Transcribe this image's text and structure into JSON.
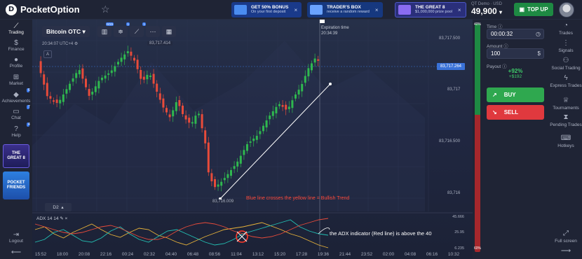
{
  "header": {
    "logo_text": "PocketOption",
    "logo_mark": "D",
    "star_icon": "☆",
    "promos": [
      {
        "title": "GET 50% BONUS",
        "subtitle": "On your first deposit",
        "close": "×"
      },
      {
        "title": "TRADER'S BOX",
        "subtitle": "receive a random reward",
        "close": "×"
      },
      {
        "title": "THE GREAT 8",
        "subtitle": "$1,000,000 prize pool",
        "close": "×"
      }
    ],
    "account_label": "QT Demo · USD",
    "balance": "49,900",
    "balance_caret": "▾",
    "topup_label": "TOP UP"
  },
  "left_sidebar": {
    "items": [
      {
        "label": "Trading",
        "icon": "chart-line-icon",
        "glyph": "📈"
      },
      {
        "label": "Finance",
        "icon": "dollar-icon",
        "glyph": "$"
      },
      {
        "label": "Profile",
        "icon": "user-icon",
        "glyph": "👤"
      },
      {
        "label": "Market",
        "icon": "cart-icon",
        "glyph": "🛒"
      },
      {
        "label": "Achievements",
        "icon": "diamond-icon",
        "glyph": "◆",
        "badge": "6"
      },
      {
        "label": "Chat",
        "icon": "chat-icon",
        "glyph": "💬",
        "badge": "7"
      },
      {
        "label": "Help",
        "icon": "help-icon",
        "glyph": "?",
        "badge": "4"
      }
    ],
    "promo_great8": [
      "THE",
      "GREAT 8"
    ],
    "promo_friends": [
      "POCKET",
      "FRIENDS"
    ],
    "logout_label": "Logout",
    "logout_glyph": "⇥",
    "collapse_glyph": "⟵"
  },
  "chart": {
    "asset": "Bitcoin OTC",
    "asset_caret": "▾",
    "tools": [
      {
        "glyph": "📊",
        "badge": "M15"
      },
      {
        "glyph": "⚙",
        "badge": "1"
      },
      {
        "glyph": "⇄",
        "badge": "1"
      },
      {
        "glyph": "✎",
        "badge": "1"
      },
      {
        "glyph": "⋯"
      },
      {
        "glyph": "▦"
      }
    ],
    "time_label": "20:34:07 UTC+4",
    "drawing_tool": "A",
    "timeframe": "D2",
    "timeframe_caret": "▴",
    "expiration_label": "Expiration time",
    "expiration_time": "20:34:39",
    "price_ticks": [
      "83,717.500",
      "83,717",
      "83,716.500",
      "83,716"
    ],
    "current_price": "83,717.264",
    "high_label": "83,717.414",
    "low_label": "83,716.009",
    "annotation_top": "Blue line crosses the yellow line = Bullish Trend",
    "annotation_bottom": "the ADX indicator (Red line) is above the 40",
    "adx_label": "ADX 14 14",
    "adx_ticks": [
      "45.666",
      "25.95",
      "6.235"
    ],
    "x_ticks": [
      "15:52",
      "18:00",
      "20:08",
      "22:16",
      "00:24",
      "02:32",
      "04:40",
      "06:48",
      "08:56",
      "11:04",
      "13:12",
      "15:20",
      "17:28",
      "19:36",
      "21:44",
      "23:52",
      "02:00",
      "04:08",
      "06:16",
      "10:32"
    ],
    "colors": {
      "up": "#2fb84f",
      "down": "#e84b3a",
      "adx_red": "#e84b3a",
      "adx_yellow": "#e8b33a",
      "adx_blue": "#23c2b5"
    }
  },
  "chart_data": {
    "type": "candlestick",
    "ylim": [
      83715.8,
      83717.65
    ],
    "trend_arrow": {
      "from": [
        74,
        83716.08
      ],
      "to": [
        109,
        83717.1
      ]
    },
    "candles_summary": "downtrend then strong uptrend ending near 83,717.264"
  },
  "trade_panel": {
    "time_label": "Time",
    "time_value": "00:00:32",
    "amount_label": "Amount",
    "amount_value": "100",
    "payout_label": "Payout",
    "payout_percent": "+92%",
    "payout_amount": "+$192",
    "buy_label": "BUY",
    "sell_label": "SELL",
    "buy_glyph": "↗",
    "sell_glyph": "↘",
    "meter_top": "40%",
    "meter_bottom": "60%"
  },
  "right_sidebar": {
    "items": [
      {
        "label": "Trades",
        "glyph": "⏱"
      },
      {
        "label": "Signals",
        "glyph": "📶"
      },
      {
        "label": "Social Trading",
        "glyph": "👥"
      },
      {
        "label": "Express Trades",
        "glyph": "⚡"
      },
      {
        "label": "Tournaments",
        "glyph": "🏆"
      },
      {
        "label": "Pending Trades",
        "glyph": "⏳"
      },
      {
        "label": "Hotkeys",
        "glyph": "⌨"
      }
    ],
    "fullscreen_label": "Full screen",
    "fullscreen_glyph": "⤢",
    "expand_glyph": "⟶"
  }
}
